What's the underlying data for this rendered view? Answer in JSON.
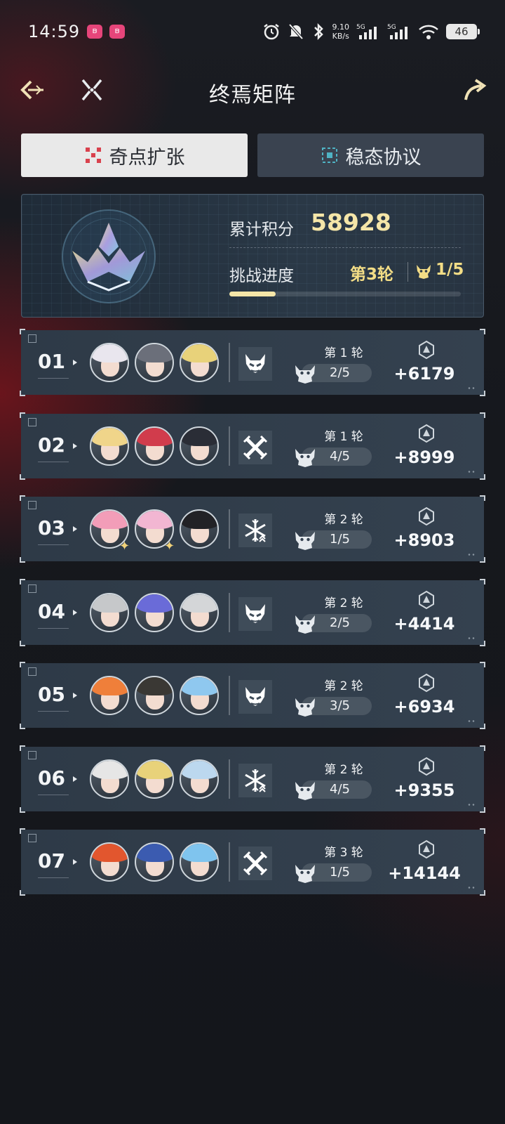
{
  "status_bar": {
    "time": "14:59",
    "net_speed_value": "9.10",
    "net_speed_unit": "KB/s",
    "signal_1": "5G",
    "signal_2": "5G",
    "battery": "46"
  },
  "header": {
    "title": "终焉矩阵"
  },
  "tabs": [
    {
      "label": "奇点扩张",
      "active": true
    },
    {
      "label": "稳态协议",
      "active": false
    }
  ],
  "summary": {
    "score_label": "累计积分",
    "score_value": "58928",
    "progress_label": "挑战进度",
    "current_round": "第3轮",
    "stage_progress": "1/5",
    "progress_fraction": 0.2
  },
  "rows": [
    {
      "number": "01",
      "element": "demon-icon",
      "round": "第 1 轮",
      "stage": "2/5",
      "points": "+6179"
    },
    {
      "number": "02",
      "element": "swords-icon",
      "round": "第 1 轮",
      "stage": "4/5",
      "points": "+8999"
    },
    {
      "number": "03",
      "element": "snowflake-icon",
      "round": "第 2 轮",
      "stage": "1/5",
      "points": "+8903"
    },
    {
      "number": "04",
      "element": "demon-icon",
      "round": "第 2 轮",
      "stage": "2/5",
      "points": "+4414"
    },
    {
      "number": "05",
      "element": "demon-icon",
      "round": "第 2 轮",
      "stage": "3/5",
      "points": "+6934"
    },
    {
      "number": "06",
      "element": "snowflake-icon",
      "round": "第 2 轮",
      "stage": "4/5",
      "points": "+9355"
    },
    {
      "number": "07",
      "element": "swords-icon",
      "round": "第 3 轮",
      "stage": "1/5",
      "points": "+14144"
    }
  ],
  "colors": {
    "accent_gold": "#f5e6a8",
    "active_tab": "#e9e9e9",
    "inactive_tab": "#3a4350",
    "row_bg": "#34414f"
  }
}
